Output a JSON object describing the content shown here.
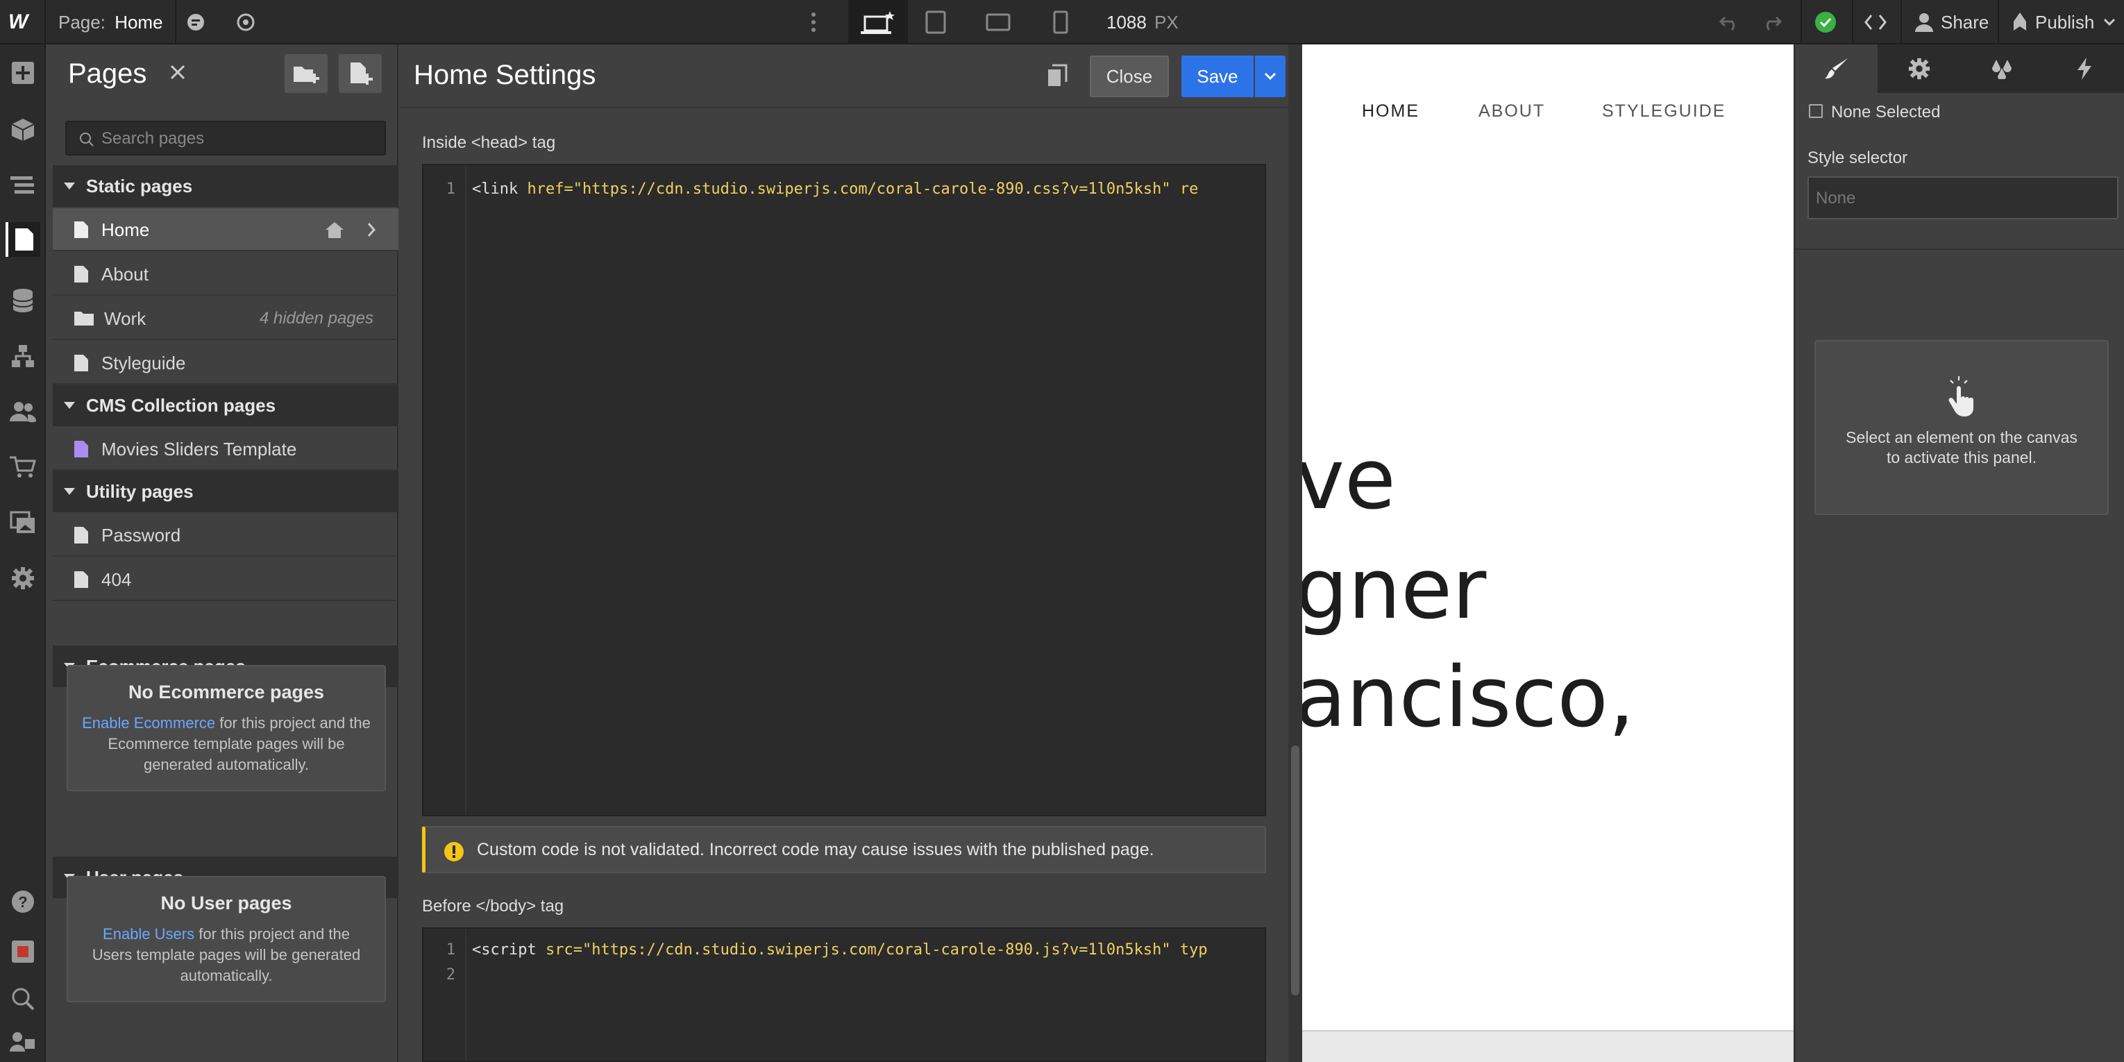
{
  "topbar": {
    "logo": "W",
    "page_label": "Page:",
    "page_name": "Home",
    "width_value": "1088",
    "width_unit": "PX",
    "share": "Share",
    "publish": "Publish",
    "icons": [
      "webflow-logo-icon",
      "comment-icon",
      "preview-eye-icon",
      "more-vertical-icon",
      "desktop-breakpoint-icon",
      "tablet-icon",
      "mobile-landscape-icon",
      "mobile-portrait-icon",
      "undo-icon",
      "redo-icon",
      "status-check-icon",
      "code-export-icon",
      "user-icon",
      "publish-rocket-icon",
      "chevron-down-icon"
    ]
  },
  "rail": {
    "icons": [
      "add-icon",
      "components-box-icon",
      "navigator-icon",
      "pages-icon",
      "cms-database-icon",
      "logic-flow-icon",
      "users-icon",
      "ecommerce-cart-icon",
      "assets-images-icon",
      "settings-gear-icon",
      "help-icon",
      "video-icon",
      "search-icon",
      "audit-icon"
    ]
  },
  "pages": {
    "title": "Pages",
    "search_placeholder": "Search pages",
    "static_header": "Static pages",
    "static": [
      {
        "label": "Home",
        "extra": ""
      },
      {
        "label": "About",
        "extra": ""
      },
      {
        "label": "Work",
        "extra": "4 hidden pages"
      },
      {
        "label": "Styleguide",
        "extra": ""
      }
    ],
    "cms_header": "CMS Collection pages",
    "cms": [
      {
        "label": "Movies Sliders Template"
      }
    ],
    "utility_header": "Utility pages",
    "utility": [
      {
        "label": "Password"
      },
      {
        "label": "404"
      }
    ],
    "ecommerce_header": "Ecommerce pages",
    "ecommerce_box": {
      "title": "No Ecommerce pages",
      "link": "Enable Ecommerce",
      "text": "for this project and the Ecommerce template pages will be generated automatically."
    },
    "user_header": "User pages",
    "user_box": {
      "title": "No User pages",
      "link": "Enable Users",
      "text": "for this project and the Users template pages will be generated automatically."
    }
  },
  "settings": {
    "title": "Home Settings",
    "close": "Close",
    "save": "Save",
    "head_label": "Inside <head> tag",
    "head_code": {
      "line": "1",
      "tag": "<link",
      "attr": " href=",
      "str": "\"https://cdn.studio.swiperjs.com/coral-carole-890.css?v=1l0n5ksh\"",
      "rest": " re"
    },
    "warning": "Custom code is not validated. Incorrect code may cause issues with the published page.",
    "body_label": "Before </body> tag",
    "body_code": {
      "line1": "1",
      "line2": "2",
      "tag": "<script",
      "attr": " src=",
      "str": "\"https://cdn.studio.swiperjs.com/coral-carole-890.js?v=1l0n5ksh\"",
      "rest": " typ"
    }
  },
  "canvas": {
    "nav": [
      "HOME",
      "ABOUT",
      "STYLEGUIDE"
    ],
    "lines": [
      "ve",
      "gner",
      "ancisco,"
    ]
  },
  "right": {
    "tab_icons": [
      "style-brush-icon",
      "element-settings-gear-icon",
      "style-manager-drops-icon",
      "interactions-lightning-icon"
    ],
    "none_selected": "None Selected",
    "selector_label": "Style selector",
    "selector_placeholder": "None",
    "empty_text": "Select an element on the canvas to activate this panel."
  },
  "colors": {
    "accent": "#2d73e8",
    "success": "#3cb043",
    "warning": "#f5c518",
    "cms_doc": "#a98cf0"
  }
}
